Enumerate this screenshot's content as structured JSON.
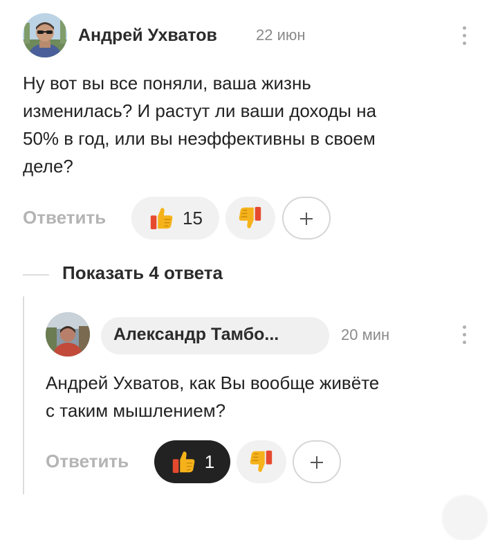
{
  "comment": {
    "author": "Андрей Ухватов",
    "time": "22 июн",
    "text_lines": [
      "Ну вот вы все поняли, ваша жизнь",
      "изменилась? И растут ли ваши доходы на",
      "50% в год, или вы неэффективны в своем",
      "деле?"
    ],
    "reply_label": "Ответить",
    "likes": "15",
    "avatar_icon": "user-avatar-photo",
    "menu_icon": "more-vertical-icon"
  },
  "thread": {
    "show_replies_label": "Показать 4 ответа"
  },
  "reply": {
    "author": "Александр Тамбо...",
    "time": "20 мин",
    "text_lines": [
      "Андрей Ухватов, как Вы вообще живёте",
      "с таким мышлением?"
    ],
    "reply_label": "Ответить",
    "likes": "1",
    "avatar_icon": "user-avatar-photo",
    "menu_icon": "more-vertical-icon"
  },
  "icons": {
    "like": "thumbs-up-icon",
    "dislike": "thumbs-down-icon",
    "add_reaction": "plus-icon"
  },
  "colors": {
    "emoji_yellow": "#f5b21a",
    "emoji_red": "#e64a2e",
    "liked_pill": "#222222",
    "pill_bg": "#f1f1f1",
    "muted_text": "#b4b4b4"
  }
}
